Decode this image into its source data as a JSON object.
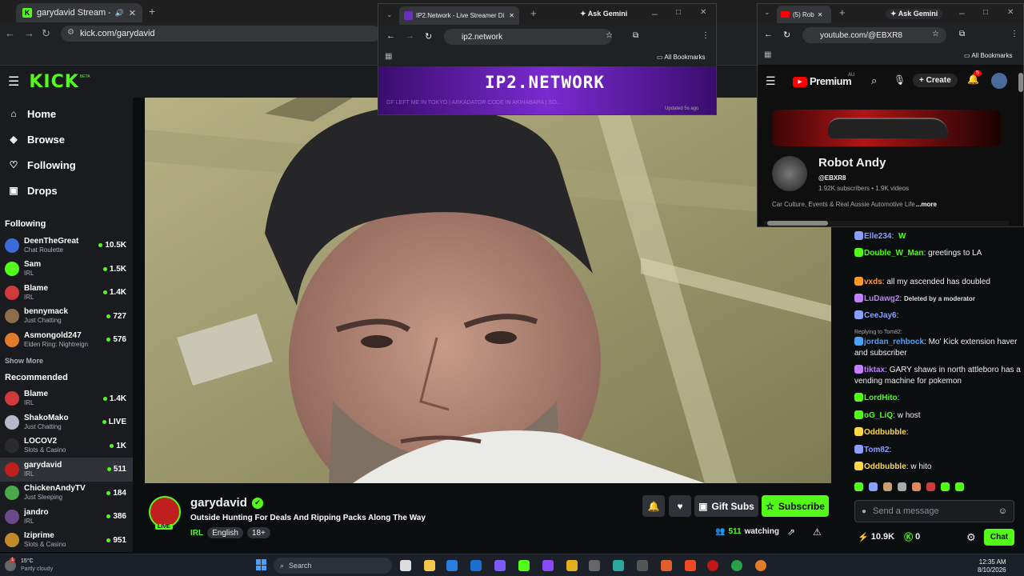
{
  "browser": {
    "tab_title": "garydavid Stream - Watch Li",
    "address": "kick.com/garydavid"
  },
  "kick": {
    "logo": "KICK",
    "logo_beta": "BETA",
    "nav": [
      {
        "label": "Home",
        "icon": "home-icon"
      },
      {
        "label": "Browse",
        "icon": "compass-icon"
      },
      {
        "label": "Following",
        "icon": "heart-icon"
      },
      {
        "label": "Drops",
        "icon": "gift-icon"
      }
    ],
    "following_title": "Following",
    "following": [
      {
        "name": "DeenTheGreat",
        "category": "Chat Roulette",
        "viewers": "10.5K",
        "color": "#3a6bd8"
      },
      {
        "name": "Sam",
        "category": "IRL",
        "viewers": "1.5K",
        "color": "#53fc18"
      },
      {
        "name": "Blame",
        "category": "IRL",
        "viewers": "1.4K",
        "color": "#d03a3a"
      },
      {
        "name": "bennymack",
        "category": "Just Chatting",
        "viewers": "727",
        "color": "#8a6d4a"
      },
      {
        "name": "Asmongold247",
        "category": "Elden Ring: Nightreign",
        "viewers": "576",
        "color": "#e07b2a"
      }
    ],
    "show_more": "Show More",
    "recommended_title": "Recommended",
    "recommended": [
      {
        "name": "Blame",
        "category": "IRL",
        "viewers": "1.4K",
        "color": "#d03a3a"
      },
      {
        "name": "ShakoMako",
        "category": "Just Chatting",
        "viewers": "LIVE",
        "color": "#b8b8c8"
      },
      {
        "name": "LOCOV2",
        "category": "Slots & Casino",
        "viewers": "1K",
        "color": "#2b2b2b"
      },
      {
        "name": "garydavid",
        "category": "IRL",
        "viewers": "511",
        "color": "#c0201d"
      },
      {
        "name": "ChickenAndyTV",
        "category": "Just Sleeping",
        "viewers": "184",
        "color": "#4aa84a"
      },
      {
        "name": "jandro",
        "category": "IRL",
        "viewers": "386",
        "color": "#6a4a8a"
      },
      {
        "name": "Iziprime",
        "category": "Slots & Casino",
        "viewers": "951",
        "color": "#c08a2a"
      }
    ],
    "stream": {
      "channel": "garydavid",
      "live_label": "LIVE",
      "title": "Outside Hunting For Deals And Ripping Packs Along The Way",
      "tags": [
        "IRL",
        "English",
        "18+"
      ],
      "viewer_count": "511",
      "viewer_suffix": "watching",
      "gift_subs": "Gift Subs",
      "subscribe": "Subscribe"
    },
    "chat": {
      "messages": [
        {
          "user": "Elle234",
          "text": "",
          "emote": "W",
          "color": "#8ca0ff",
          "top": 0
        },
        {
          "user": "Double_W_Man",
          "text": "greetings to LA",
          "color": "#53fc18"
        },
        {
          "user": "vxds",
          "text": "all my ascended has doubled",
          "color": "#ff9a2a"
        },
        {
          "user": "LuDawg2",
          "text": "Deleted by a moderator",
          "color": "#c080ff"
        },
        {
          "user": "CeeJay6",
          "text": "",
          "color": "#8ca0ff"
        },
        {
          "reply": "Replying to Tom82:",
          "user": "jordan_rehbock",
          "text": "Mo' Kick extension haver and subscriber",
          "color": "#4aa0ff"
        },
        {
          "user": "tiktax",
          "text": "GARY shaws in north attleboro has a vending machine for pokemon",
          "color": "#c080ff"
        },
        {
          "user": "LordHito",
          "text": "",
          "color": "#53fc18"
        },
        {
          "user": "oG_LiQ",
          "text": "w host",
          "color": "#53fc18"
        },
        {
          "user": "Oddbubble",
          "text": "",
          "color": "#ffd84a"
        },
        {
          "user": "Tom82",
          "text": "",
          "color": "#8ca0ff"
        },
        {
          "user": "Oddbubble",
          "text": "w hito",
          "color": "#ffd84a"
        }
      ],
      "input_placeholder": "Send a message",
      "points": "10.9K",
      "kicks": "0",
      "chat_button": "Chat"
    }
  },
  "popup_ip2": {
    "tab_title": "IP2.Network - Live Streamer Di",
    "address": "ip2.network",
    "ask_gemini": "Ask Gemini",
    "bookmarks": "All Bookmarks",
    "banner": "IP2.NETWORK",
    "ticker": "GF LEFT ME IN TOKYO   |   ARKADATOR CODE IN AKIHABARA   |   SO...",
    "updated": "Updated 5s ago"
  },
  "popup_yt": {
    "tab_title": "(5) Rob",
    "address": "youtube.com/@EBXR8",
    "ask_gemini": "Ask Gemini",
    "bookmarks": "All Bookmarks",
    "logo": "Premium",
    "region": "AU",
    "create": "Create",
    "notifications": "5",
    "channel_name": "Robot Andy",
    "handle": "@EBXR8",
    "stats": "1.92K subscribers • 1.9K videos",
    "description": "Car Culture, Events & Real Aussie Automotive Life",
    "more": "...more"
  },
  "taskbar": {
    "weather_temp": "15°C",
    "weather_desc": "Partly cloudy",
    "weather_badge": "1",
    "search": "Search",
    "time": "12:35 AM",
    "date": "8/10/2026"
  }
}
